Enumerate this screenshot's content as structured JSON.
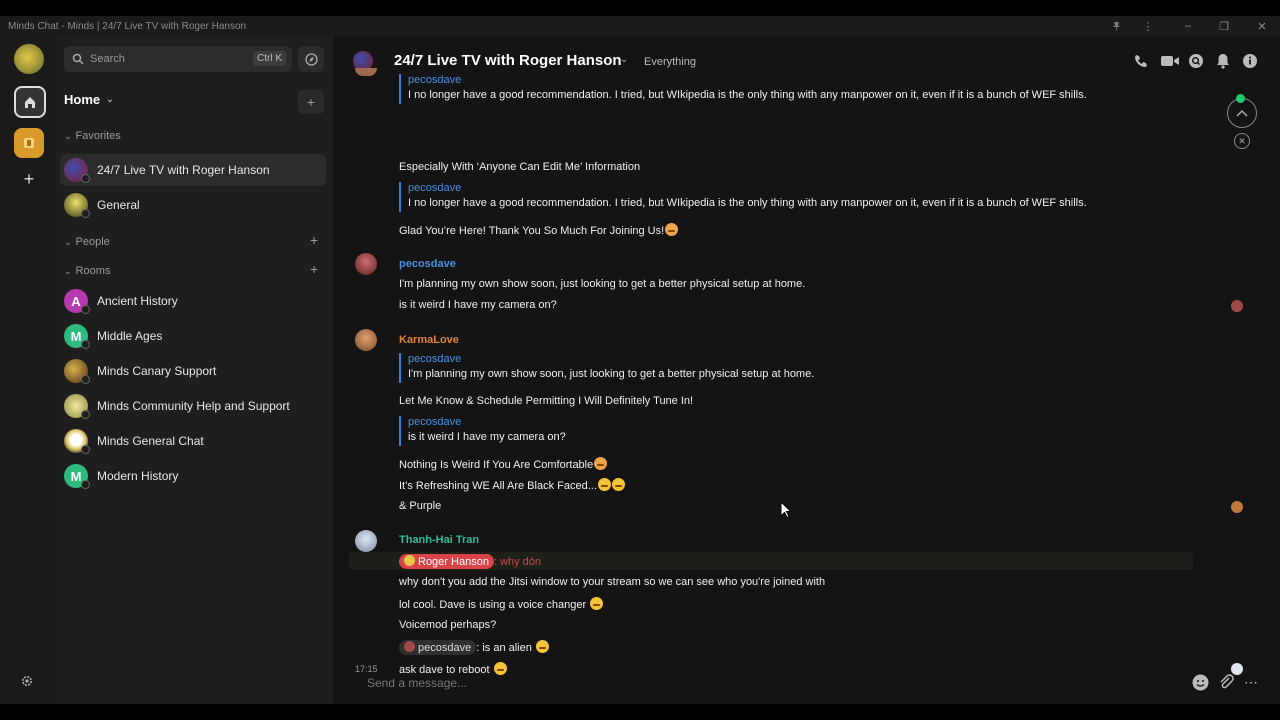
{
  "window": {
    "title": "Minds Chat - Minds | 24/7 Live TV with Roger Hanson"
  },
  "sidebar": {
    "search_placeholder": "Search",
    "search_shortcut": "Ctrl K",
    "home_label": "Home",
    "favorites_label": "Favorites",
    "people_label": "People",
    "rooms_label": "Rooms",
    "favorites": [
      {
        "name": "24/7 Live TV with Roger Hanson",
        "active": true
      },
      {
        "name": "General"
      }
    ],
    "rooms": [
      {
        "name": "Ancient History",
        "letter": "A",
        "color": "#b93ab0"
      },
      {
        "name": "Middle Ages",
        "letter": "M",
        "color": "#2dbb80"
      },
      {
        "name": "Minds Canary Support"
      },
      {
        "name": "Minds Community Help and Support"
      },
      {
        "name": "Minds General Chat"
      },
      {
        "name": "Modern History",
        "letter": "M",
        "color": "#2dbb80"
      }
    ]
  },
  "header": {
    "room_title": "24/7 Live TV with Roger Hanson",
    "topic": "Everything"
  },
  "timeline": {
    "block1": {
      "q1_sender": "pecosdave",
      "q1_body": "I no longer have a good recommendation.  I tried, but WIkipedia is the only thing with any manpower on it, even if it is a bunch of WEF shills.",
      "line1": "Especially With ‘Anyone Can Edit Me’ Information",
      "q2_sender": "pecosdave",
      "q2_body": "I no longer have a good recommendation.  I tried, but WIkipedia is the only thing with any manpower on it, even if it is a bunch of WEF shills.",
      "line2": "Glad You’re Here! Thank You So Much For Joining Us!"
    },
    "block2": {
      "sender": "pecosdave",
      "line1": "I'm planning my own show soon, just looking to get a better physical setup at home.",
      "line2": "is it weird I have my camera on?"
    },
    "block3": {
      "sender": "KarmaLove",
      "q1_sender": "pecosdave",
      "q1_body": "I'm planning my own show soon, just looking to get a better physical setup at home.",
      "line1": "Let Me Know & Schedule Permitting I Will Definitely Tune In!",
      "q2_sender": "pecosdave",
      "q2_body": "is it weird I have my camera on?",
      "line2": "Nothing Is Weird If You Are Comfortable",
      "line3": "It’s Refreshing WE All Are Black Faced...",
      "line4": "& Purple"
    },
    "block4": {
      "sender": "Thanh-Hai Tran",
      "mention": "Roger Hanson",
      "mention_suffix": ": why dón",
      "line1": "why don't you add the Jitsi window to your stream so we can see who you're joined with",
      "line2": "lol cool. Dave is using a voice changer",
      "line3": "Voicemod perhaps?",
      "mention2": "pecosdave",
      "mention2_suffix": ": is an alien",
      "timestamp": "17:15",
      "line5": "ask dave to reboot"
    }
  },
  "composer": {
    "placeholder": "Send a message..."
  },
  "colors": {
    "accent_blue": "#4b8fe0",
    "karmalove": "#e0833a",
    "thanh_hai": "#2dbb9a",
    "mention_red": "#d9434a",
    "online_green": "#1ecb6b"
  }
}
